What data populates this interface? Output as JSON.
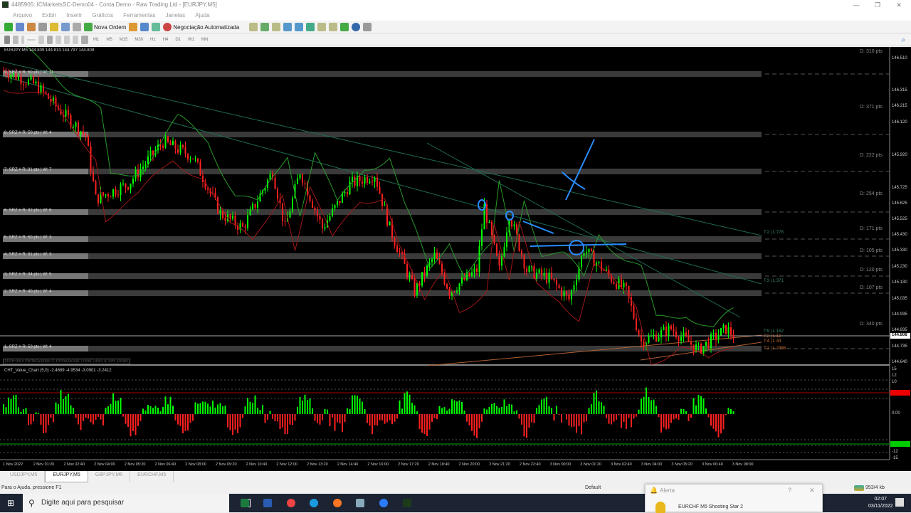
{
  "window": {
    "title": "4485905: ICMarketsSC-Demo04 - Conta Demo - Raw Trading Ltd - [EURJPY,M5]"
  },
  "menu": [
    "Arquivo",
    "Exibir",
    "Inserir",
    "Gráficos",
    "Ferramentas",
    "Janelas",
    "Ajuda"
  ],
  "toolbar": {
    "new_order": "Nova Ordem",
    "algo_trading": "Negociação Automatizada"
  },
  "timeframes": [
    "M1",
    "M5",
    "M15",
    "M30",
    "H1",
    "H4",
    "D1",
    "W1",
    "MN"
  ],
  "chart": {
    "header": "EURJPY,M5  144.809 144.813 144.797 144.808",
    "zone_footer": "DonForex PerfectZones © Professional Trend Lines & S/R Zones",
    "indicator_header": "CHT_Value_Chart (5,0) -2.4689 -4.9534 -3.0901 -3.2412",
    "zones": [
      "9. SRZ # R: 50 pts | W: 11",
      "8. SRZ # R: 50 pts | W: 4",
      "7. SRZ # R: 31 pts | W: 7",
      "6. SRZ # R: 32 pts | W: 6",
      "5. SRZ # R: 50 pts | W: 3",
      "4. SRZ # R: 31 pts | W: 3",
      "3. SRZ # R: 34 pts | W: 5",
      "2. SRZ # R: 40 pts | W: 4",
      "1. SRZ # R: 50 pts | W: 4"
    ],
    "distances": [
      "D: 310 pts",
      "D: 371 pts",
      "D: 222 pts",
      "D: 254 pts",
      "D: 171 pts",
      "D: 105 pts",
      "D: 120 pts",
      "D: 107 pts",
      "D: 340 pts"
    ],
    "trend_labels": [
      "T:2 | L:778",
      "T:3 | L:371",
      "T:5 | L:152",
      "T:2 | L:12",
      "T:4 | L:43",
      "T:2 | L:2355"
    ],
    "price_ticks": [
      "146.510",
      "146.315",
      "146.215",
      "146.120",
      "145.920",
      "145.725",
      "145.625",
      "145.525",
      "145.430",
      "145.330",
      "145.230",
      "145.130",
      "145.035",
      "144.935",
      "144.835",
      "144.735",
      "144.640"
    ],
    "current_price": "144.808",
    "indicator_ticks": [
      "15",
      "12",
      "10",
      "0.00",
      "-12",
      "-15"
    ],
    "time_labels": [
      "1 Nov 2022",
      "2 Nov 01:20",
      "2 Nov 02:40",
      "2 Nov 04:00",
      "2 Nov 05:20",
      "2 Nov 06:40",
      "2 Nov 08:00",
      "2 Nov 09:20",
      "2 Nov 10:40",
      "2 Nov 12:00",
      "2 Nov 13:20",
      "2 Nov 14:40",
      "2 Nov 16:00",
      "2 Nov 17:20",
      "2 Nov 18:40",
      "2 Nov 20:00",
      "2 Nov 21:20",
      "2 Nov 22:40",
      "3 Nov 00:00",
      "3 Nov 01:20",
      "3 Nov 02:40",
      "3 Nov 04:00",
      "3 Nov 05:20",
      "3 Nov 06:40",
      "3 Nov 08:00"
    ],
    "price_path": [
      [
        0,
        146.44
      ],
      [
        13,
        146.35
      ],
      [
        21,
        146.22
      ],
      [
        33,
        146.04
      ],
      [
        37,
        145.65
      ],
      [
        50,
        145.74
      ],
      [
        64,
        146.0
      ],
      [
        76,
        145.91
      ],
      [
        87,
        145.56
      ],
      [
        96,
        145.47
      ],
      [
        108,
        145.82
      ],
      [
        113,
        145.47
      ],
      [
        119,
        145.82
      ],
      [
        128,
        145.47
      ],
      [
        139,
        145.74
      ],
      [
        149,
        145.8
      ],
      [
        155,
        145.47
      ],
      [
        165,
        145.08
      ],
      [
        173,
        145.3
      ],
      [
        179,
        145.08
      ],
      [
        190,
        145.21
      ],
      [
        193,
        145.6
      ],
      [
        199,
        145.21
      ],
      [
        203,
        145.56
      ],
      [
        210,
        145.21
      ],
      [
        219,
        145.16
      ],
      [
        227,
        145.03
      ],
      [
        233,
        145.34
      ],
      [
        244,
        145.16
      ],
      [
        250,
        145.08
      ],
      [
        256,
        144.77
      ],
      [
        268,
        144.85
      ],
      [
        279,
        144.72
      ],
      [
        290,
        144.85
      ],
      [
        293,
        144.81
      ]
    ],
    "colors": {
      "bull": "#00ff00",
      "bear": "#ff2020",
      "ma_upper": "#2a9a2a",
      "ma_lower": "#a01818",
      "annotation": "#2a8cff"
    }
  },
  "tabs": [
    "USDJPY,M5",
    "EURJPY,M5",
    "GBPJPY,M5",
    "EURCHF,M5"
  ],
  "status": {
    "help": "Para o Ajuda, pressione F1",
    "profile": "Default",
    "traffic": "953/4 kb"
  },
  "alert": {
    "title": "Alerta",
    "message": "EURCHF M5 Shooting Star 2"
  },
  "taskbar": {
    "search_placeholder": "Digite aqui para pesquisar",
    "time": "02:07",
    "date": "03/11/2022"
  }
}
